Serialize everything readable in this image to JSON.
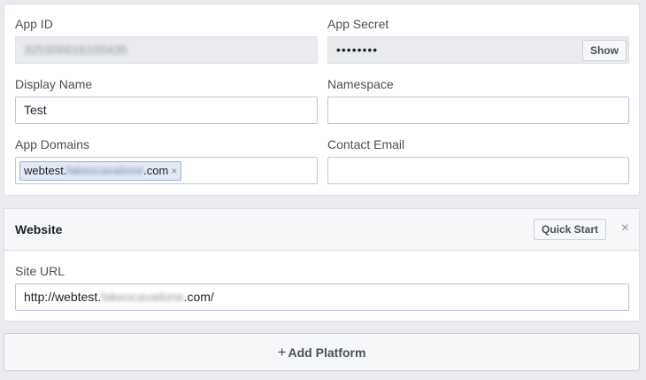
{
  "basic": {
    "app_id": {
      "label": "App ID",
      "value": "325306616105435"
    },
    "app_secret": {
      "label": "App Secret",
      "value": "••••••••",
      "show_label": "Show"
    },
    "display_name": {
      "label": "Display Name",
      "value": "Test"
    },
    "namespace": {
      "label": "Namespace",
      "value": ""
    },
    "app_domains": {
      "label": "App Domains",
      "token_prefix": "webtest.",
      "token_hidden": "fakeocavailone",
      "token_suffix": ".com",
      "token_remove": "×"
    },
    "contact_email": {
      "label": "Contact Email",
      "value": ""
    }
  },
  "website": {
    "title": "Website",
    "quick_start_label": "Quick Start",
    "close_glyph": "×",
    "site_url": {
      "label": "Site URL",
      "prefix": "http://webtest.",
      "hidden": "fakeocavailone",
      "suffix": ".com/"
    }
  },
  "add_platform": {
    "plus": "+",
    "label": "Add Platform"
  }
}
